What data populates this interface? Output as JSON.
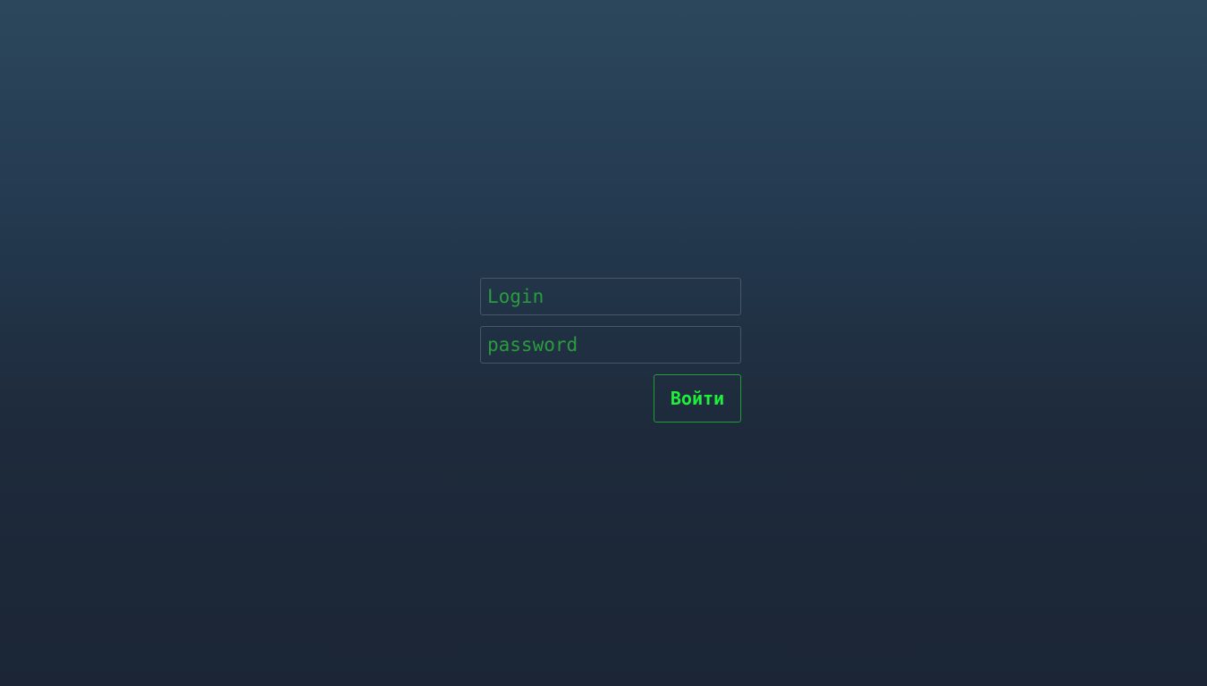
{
  "login_form": {
    "login_placeholder": "Login",
    "login_value": "",
    "password_placeholder": "password",
    "password_value": "",
    "submit_label": "Войти"
  },
  "colors": {
    "accent": "#1ef03c",
    "placeholder": "#2a9c3e",
    "background_top": "#2c475c",
    "background_bottom": "#1b2535"
  }
}
